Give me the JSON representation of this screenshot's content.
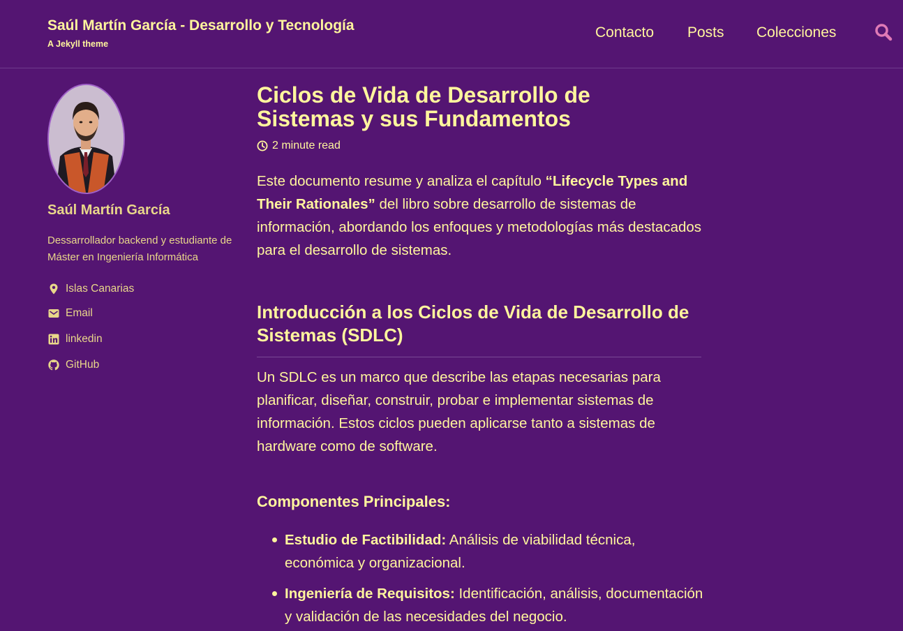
{
  "masthead": {
    "title": "Saúl Martín García - Desarrollo y Tecnología",
    "subtitle": "A Jekyll theme",
    "nav": [
      "Contacto",
      "Posts",
      "Colecciones"
    ],
    "search_icon": "search-icon"
  },
  "author": {
    "name": "Saúl Martín García",
    "bio": "Dessarrollador backend y estudiante de Máster en Ingeniería Informática",
    "links": [
      {
        "icon": "map-marker-icon",
        "label": "Islas Canarias"
      },
      {
        "icon": "envelope-icon",
        "label": "Email"
      },
      {
        "icon": "linkedin-icon",
        "label": "linkedin"
      },
      {
        "icon": "github-icon",
        "label": "GitHub"
      }
    ]
  },
  "post": {
    "title": "Ciclos de Vida de Desarrollo de Sistemas y sus Fundamentos",
    "read_time": "2 minute read",
    "intro_before": "Este documento resume y analiza el capítulo ",
    "intro_bold": "“Lifecycle Types and Their Rationales”",
    "intro_after": " del libro sobre desarrollo de sistemas de información, abordando los enfoques y metodologías más destacados para el desarrollo de sistemas.",
    "section_title": "Introducción a los Ciclos de Vida de Desarrollo de Sistemas (SDLC)",
    "section_text": "Un SDLC es un marco que describe las etapas necesarias para planificar, diseñar, construir, probar e implementar sistemas de información. Estos ciclos pueden aplicarse tanto a sistemas de hardware como de software.",
    "subsection_title": "Componentes Principales:",
    "components": [
      {
        "term": "Estudio de Factibilidad:",
        "desc": " Análisis de viabilidad técnica, económica y organizacional."
      },
      {
        "term": "Ingeniería de Requisitos:",
        "desc": " Identificación, análisis, documentación y validación de las necesidades del negocio."
      }
    ]
  },
  "colors": {
    "background": "#541572",
    "text": "#fff59d",
    "sidebar_text": "#e9d78a"
  }
}
